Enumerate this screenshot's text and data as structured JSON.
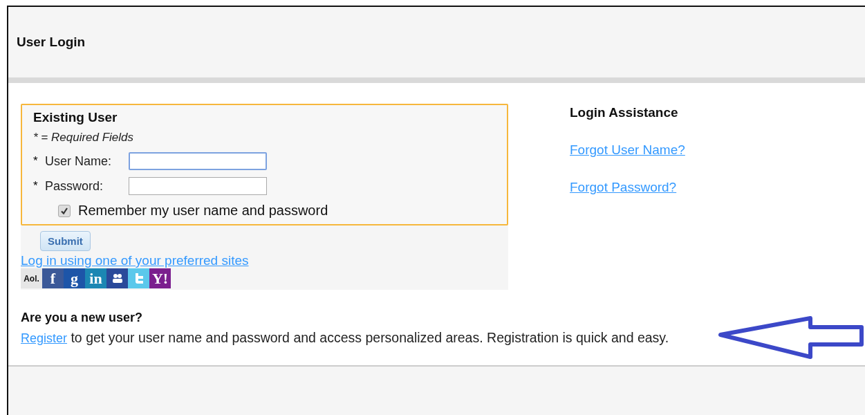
{
  "header": {
    "title": "User Login"
  },
  "existing_user": {
    "title": "Existing User",
    "required_note": "* = Required Fields",
    "fields": [
      {
        "marker": "*",
        "label": "User Name:",
        "focused": true
      },
      {
        "marker": "*",
        "label": "Password:",
        "focused": false
      }
    ],
    "remember": {
      "label": "Remember my user name and password",
      "checked": true
    },
    "submit": "Submit",
    "social_link": "Log in using one of your preferred sites",
    "social_sites": [
      {
        "kind": "text",
        "label": "Aol.",
        "color": "#e6e6e6"
      },
      {
        "kind": "text",
        "label": "f",
        "color": "#3b5998"
      },
      {
        "kind": "text",
        "label": "g",
        "color": "#1d55a8"
      },
      {
        "kind": "text",
        "label": "in",
        "color": "#1c87b3"
      },
      {
        "kind": "people",
        "color": "#2a4a9a"
      },
      {
        "kind": "bird",
        "color": "#5bc8eb"
      },
      {
        "kind": "text",
        "label": "Y!",
        "color": "#7b1f8e"
      }
    ]
  },
  "assistance": {
    "title": "Login Assistance",
    "links": [
      "Forgot User Name?",
      "Forgot Password?"
    ]
  },
  "new_user": {
    "title": "Are you a new user?",
    "link": "Register",
    "text": " to get your user name and password and access personalized areas. Registration is quick and easy."
  }
}
